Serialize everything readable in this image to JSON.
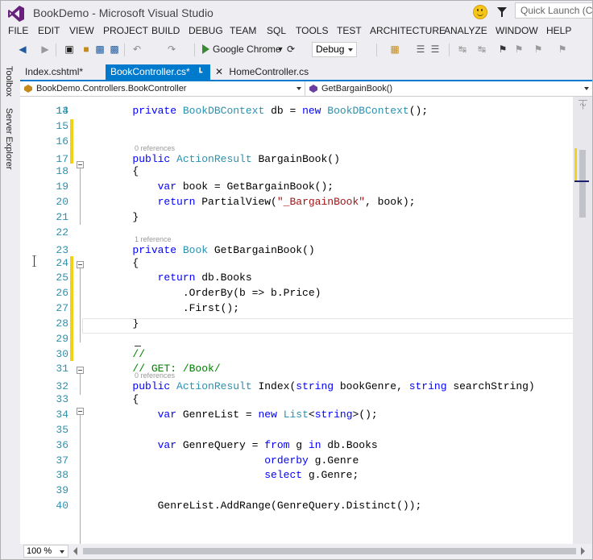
{
  "window": {
    "title": "BookDemo - Microsoft Visual Studio",
    "quick_launch_placeholder": "Quick Launch (Ctrl+Q)"
  },
  "menu": [
    "FILE",
    "EDIT",
    "VIEW",
    "PROJECT",
    "BUILD",
    "DEBUG",
    "TEAM",
    "SQL",
    "TOOLS",
    "TEST",
    "ARCHITECTURE",
    "ANALYZE",
    "WINDOW",
    "HELP"
  ],
  "toolbar": {
    "run_target": "Google Chrome",
    "configuration": "Debug"
  },
  "sidebar": {
    "tabs": [
      "Toolbox",
      "Server Explorer"
    ]
  },
  "tabs": [
    {
      "label": "Index.cshtml*",
      "active": false
    },
    {
      "label": "BookController.cs*",
      "active": true
    },
    {
      "label": "HomeController.cs",
      "active": false
    }
  ],
  "navigation": {
    "type_dropdown": "BookDemo.Controllers.BookController",
    "member_dropdown": "GetBargainBook()"
  },
  "editor": {
    "first_line_number": "13",
    "lines": [
      {
        "num": "14",
        "tokens": [
          {
            "t": "        ",
            "c": "pl"
          },
          {
            "t": "private ",
            "c": "kw"
          },
          {
            "t": "BookDBContext",
            "c": "ty"
          },
          {
            "t": " db = ",
            "c": "pl"
          },
          {
            "t": "new ",
            "c": "kw"
          },
          {
            "t": "BookDBContext",
            "c": "ty"
          },
          {
            "t": "();",
            "c": "pl"
          }
        ]
      },
      {
        "num": "15",
        "tokens": []
      },
      {
        "num": "16",
        "tokens": []
      },
      {
        "num": "17",
        "ref": "0 references",
        "tokens": [
          {
            "t": "        ",
            "c": "pl"
          },
          {
            "t": "public ",
            "c": "kw"
          },
          {
            "t": "ActionResult",
            "c": "ty"
          },
          {
            "t": " BargainBook()",
            "c": "pl"
          }
        ]
      },
      {
        "num": "18",
        "tokens": [
          {
            "t": "        {",
            "c": "pl"
          }
        ]
      },
      {
        "num": "19",
        "tokens": [
          {
            "t": "            ",
            "c": "pl"
          },
          {
            "t": "var ",
            "c": "kw"
          },
          {
            "t": "book = GetBargainBook();",
            "c": "pl"
          }
        ]
      },
      {
        "num": "20",
        "tokens": [
          {
            "t": "            ",
            "c": "pl"
          },
          {
            "t": "return ",
            "c": "kw"
          },
          {
            "t": "PartialView(",
            "c": "pl"
          },
          {
            "t": "\"_BargainBook\"",
            "c": "str"
          },
          {
            "t": ", book);",
            "c": "pl"
          }
        ]
      },
      {
        "num": "21",
        "tokens": [
          {
            "t": "        }",
            "c": "pl"
          }
        ]
      },
      {
        "num": "22",
        "tokens": []
      },
      {
        "num": "23",
        "ref": "1 reference",
        "tokens": [
          {
            "t": "        ",
            "c": "pl"
          },
          {
            "t": "private ",
            "c": "kw"
          },
          {
            "t": "Book",
            "c": "ty"
          },
          {
            "t": " GetBargainBook()",
            "c": "pl"
          }
        ]
      },
      {
        "num": "24",
        "tokens": [
          {
            "t": "        {",
            "c": "pl"
          }
        ]
      },
      {
        "num": "25",
        "tokens": [
          {
            "t": "            ",
            "c": "pl"
          },
          {
            "t": "return ",
            "c": "kw"
          },
          {
            "t": "db.Books",
            "c": "pl"
          }
        ]
      },
      {
        "num": "26",
        "tokens": [
          {
            "t": "                .OrderBy(b => b.Price)",
            "c": "pl"
          }
        ]
      },
      {
        "num": "27",
        "tokens": [
          {
            "t": "                .First();",
            "c": "pl"
          }
        ]
      },
      {
        "num": "28",
        "tokens": [
          {
            "t": "        }",
            "c": "pl"
          }
        ]
      },
      {
        "num": "29",
        "tokens": []
      },
      {
        "num": "30",
        "tokens": [
          {
            "t": "        //",
            "c": "cm"
          }
        ]
      },
      {
        "num": "31",
        "tokens": [
          {
            "t": "        // GET: /Book/",
            "c": "cm"
          }
        ]
      },
      {
        "num": "32",
        "ref": "0 references",
        "tokens": [
          {
            "t": "        ",
            "c": "pl"
          },
          {
            "t": "public ",
            "c": "kw"
          },
          {
            "t": "ActionResult",
            "c": "ty"
          },
          {
            "t": " Index(",
            "c": "pl"
          },
          {
            "t": "string ",
            "c": "kw"
          },
          {
            "t": "bookGenre, ",
            "c": "pl"
          },
          {
            "t": "string ",
            "c": "kw"
          },
          {
            "t": "searchString)",
            "c": "pl"
          }
        ]
      },
      {
        "num": "33",
        "tokens": [
          {
            "t": "        {",
            "c": "pl"
          }
        ]
      },
      {
        "num": "34",
        "tokens": [
          {
            "t": "            ",
            "c": "pl"
          },
          {
            "t": "var ",
            "c": "kw"
          },
          {
            "t": "GenreList = ",
            "c": "pl"
          },
          {
            "t": "new ",
            "c": "kw"
          },
          {
            "t": "List",
            "c": "ty"
          },
          {
            "t": "<",
            "c": "pl"
          },
          {
            "t": "string",
            "c": "kw"
          },
          {
            "t": ">();",
            "c": "pl"
          }
        ]
      },
      {
        "num": "35",
        "tokens": []
      },
      {
        "num": "36",
        "tokens": [
          {
            "t": "            ",
            "c": "pl"
          },
          {
            "t": "var ",
            "c": "kw"
          },
          {
            "t": "GenreQuery = ",
            "c": "pl"
          },
          {
            "t": "from ",
            "c": "kw"
          },
          {
            "t": "g ",
            "c": "pl"
          },
          {
            "t": "in ",
            "c": "kw"
          },
          {
            "t": "db.Books",
            "c": "pl"
          }
        ]
      },
      {
        "num": "37",
        "tokens": [
          {
            "t": "                             ",
            "c": "pl"
          },
          {
            "t": "orderby ",
            "c": "kw"
          },
          {
            "t": "g.Genre",
            "c": "pl"
          }
        ]
      },
      {
        "num": "38",
        "tokens": [
          {
            "t": "                             ",
            "c": "pl"
          },
          {
            "t": "select ",
            "c": "kw"
          },
          {
            "t": "g.Genre;",
            "c": "pl"
          }
        ]
      },
      {
        "num": "39",
        "tokens": []
      },
      {
        "num": "40",
        "tokens": [
          {
            "t": "            GenreList.AddRange(GenreQuery.Distinct());",
            "c": "pl"
          }
        ]
      }
    ]
  },
  "status": {
    "zoom": "100 %"
  }
}
